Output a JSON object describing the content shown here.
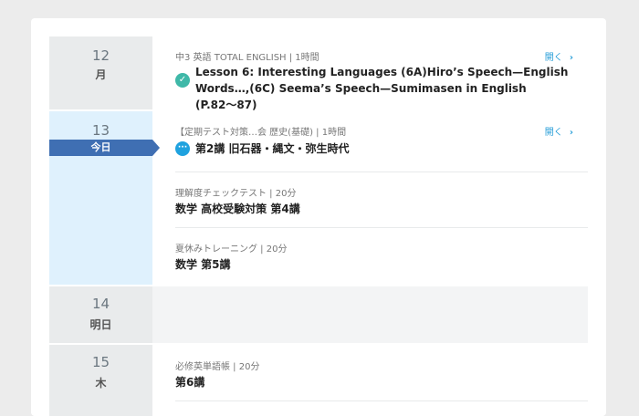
{
  "days": [
    {
      "number": "12",
      "label": "月",
      "entries": [
        {
          "meta": "中3 英語 TOTAL ENGLISH | 1時間",
          "title": "Lesson 6: Interesting Languages (6A)Hiro’s Speech—English Words…,(6C) Seema’s Speech—Sumimasen in English (P.82〜87)",
          "status": "completed",
          "status_icon": "check-circle-icon",
          "open_label": "開く"
        }
      ]
    },
    {
      "number": "13",
      "label": "今日",
      "entries": [
        {
          "meta": "【定期テスト対策…会 歴史(基礎) | 1時間",
          "title": "第2講 旧石器・縄文・弥生時代",
          "status": "in-progress",
          "status_icon": "ellipsis-circle-icon",
          "open_label": "開く"
        },
        {
          "meta": "理解度チェックテスト | 20分",
          "title": "数学 高校受験対策 第4講"
        },
        {
          "meta": "夏休みトレーニング | 20分",
          "title": "数学 第5講"
        }
      ]
    },
    {
      "number": "14",
      "label": "明日",
      "entries": []
    },
    {
      "number": "15",
      "label": "木",
      "entries": [
        {
          "meta": "必修英単語帳 | 20分",
          "title": "第6講"
        }
      ]
    }
  ],
  "colors": {
    "check": "#3fb8a8",
    "progress": "#1fa2df",
    "today_banner": "#3f6fb3",
    "link": "#2a9fd8"
  }
}
